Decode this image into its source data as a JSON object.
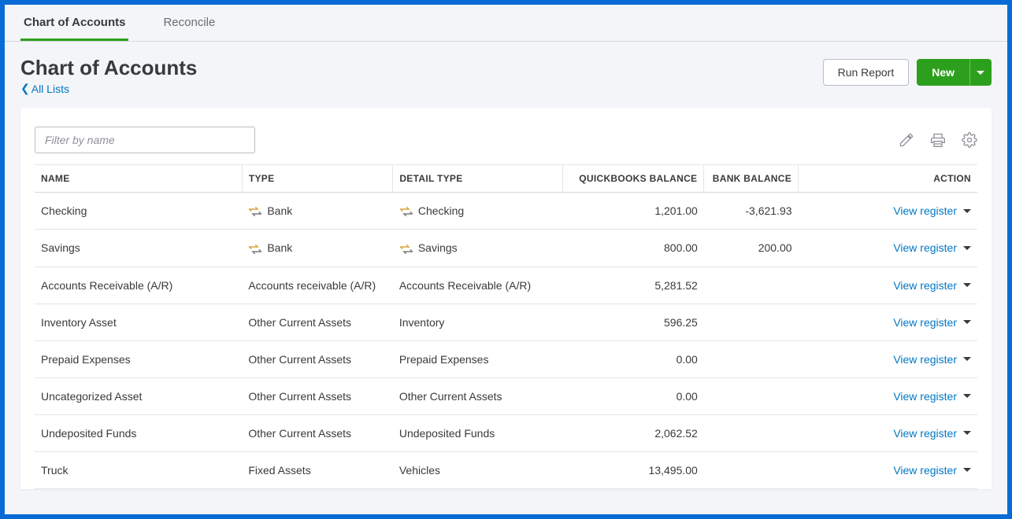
{
  "tabs": {
    "chart_of_accounts": "Chart of Accounts",
    "reconcile": "Reconcile"
  },
  "header": {
    "title": "Chart of Accounts",
    "back_link": "All Lists",
    "run_report": "Run Report",
    "new_button": "New"
  },
  "toolbar": {
    "filter_placeholder": "Filter by name"
  },
  "columns": {
    "name": "NAME",
    "type": "TYPE",
    "detail_type": "DETAIL TYPE",
    "qb_balance": "QUICKBOOKS BALANCE",
    "bank_balance": "BANK BALANCE",
    "action": "ACTION"
  },
  "action_label": "View register",
  "rows": [
    {
      "name": "Checking",
      "type": "Bank",
      "detail": "Checking",
      "qb_balance": "1,201.00",
      "bank_balance": "-3,621.93",
      "has_icon": true
    },
    {
      "name": "Savings",
      "type": "Bank",
      "detail": "Savings",
      "qb_balance": "800.00",
      "bank_balance": "200.00",
      "has_icon": true
    },
    {
      "name": "Accounts Receivable (A/R)",
      "type": "Accounts receivable (A/R)",
      "detail": "Accounts Receivable (A/R)",
      "qb_balance": "5,281.52",
      "bank_balance": "",
      "has_icon": false
    },
    {
      "name": "Inventory Asset",
      "type": "Other Current Assets",
      "detail": "Inventory",
      "qb_balance": "596.25",
      "bank_balance": "",
      "has_icon": false
    },
    {
      "name": "Prepaid Expenses",
      "type": "Other Current Assets",
      "detail": "Prepaid Expenses",
      "qb_balance": "0.00",
      "bank_balance": "",
      "has_icon": false
    },
    {
      "name": "Uncategorized Asset",
      "type": "Other Current Assets",
      "detail": "Other Current Assets",
      "qb_balance": "0.00",
      "bank_balance": "",
      "has_icon": false
    },
    {
      "name": "Undeposited Funds",
      "type": "Other Current Assets",
      "detail": "Undeposited Funds",
      "qb_balance": "2,062.52",
      "bank_balance": "",
      "has_icon": false
    },
    {
      "name": "Truck",
      "type": "Fixed Assets",
      "detail": "Vehicles",
      "qb_balance": "13,495.00",
      "bank_balance": "",
      "has_icon": false
    }
  ]
}
